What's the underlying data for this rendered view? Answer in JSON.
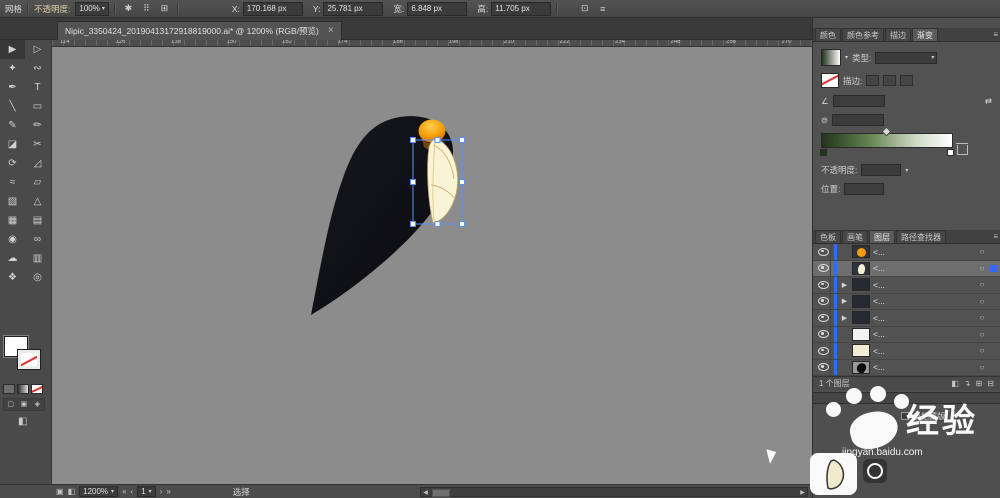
{
  "top_bar": {
    "left_label": "网格",
    "opacity_label": "不透明度:",
    "opacity_value": "100%",
    "dropdown_glyph": "▾",
    "icons": [
      {
        "name": "style-icon",
        "glyph": "✱",
        "slot": "pre"
      },
      {
        "name": "reference-point-icon",
        "glyph": "⠿",
        "slot": "pre"
      },
      {
        "name": "align-icon",
        "glyph": "⊞",
        "slot": "pre"
      },
      {
        "name": "transform-icon",
        "glyph": "⊡",
        "slot": "post"
      },
      {
        "name": "control-menu-icon",
        "glyph": "≡",
        "slot": "post"
      }
    ],
    "fields": [
      {
        "label": "X:",
        "value": "170.168 px"
      },
      {
        "label": "Y:",
        "value": "25.781 px"
      },
      {
        "label": "宽:",
        "value": "6.848 px"
      },
      {
        "label": "高:",
        "value": "11.705 px"
      }
    ]
  },
  "doc_tab": {
    "title": "Nipic_3350424_20190413172918819000.ai* @ 1200% (RGB/预览)",
    "close_glyph": "×"
  },
  "ruler": {
    "start": 114,
    "step": 12,
    "count": 14
  },
  "toolbar": {
    "tools": [
      {
        "name": "selection-tool",
        "glyph": "▶"
      },
      {
        "name": "direct-selection-tool",
        "glyph": "▷"
      },
      {
        "name": "magic-wand-tool",
        "glyph": "✦"
      },
      {
        "name": "lasso-tool",
        "glyph": "∾"
      },
      {
        "name": "pen-tool",
        "glyph": "✒"
      },
      {
        "name": "type-tool",
        "glyph": "T"
      },
      {
        "name": "line-segment-tool",
        "glyph": "╲"
      },
      {
        "name": "rectangle-tool",
        "glyph": "▭"
      },
      {
        "name": "paintbrush-tool",
        "glyph": "✎"
      },
      {
        "name": "pencil-tool",
        "glyph": "✏"
      },
      {
        "name": "eraser-tool",
        "glyph": "◪"
      },
      {
        "name": "scissors-tool",
        "glyph": "✂"
      },
      {
        "name": "rotate-tool",
        "glyph": "⟳"
      },
      {
        "name": "scale-tool",
        "glyph": "◿"
      },
      {
        "name": "width-tool",
        "glyph": "≈"
      },
      {
        "name": "free-transform-tool",
        "glyph": "▱"
      },
      {
        "name": "shape-builder-tool",
        "glyph": "▧"
      },
      {
        "name": "perspective-grid-tool",
        "glyph": "△"
      },
      {
        "name": "mesh-tool",
        "glyph": "▦"
      },
      {
        "name": "gradient-tool",
        "glyph": "▤"
      },
      {
        "name": "eyedropper-tool",
        "glyph": "◉"
      },
      {
        "name": "blend-tool",
        "glyph": "∞"
      },
      {
        "name": "symbol-sprayer-tool",
        "glyph": "☁"
      },
      {
        "name": "column-graph-tool",
        "glyph": "▥"
      },
      {
        "name": "hand-tool",
        "glyph": "❖"
      },
      {
        "name": "zoom-tool",
        "glyph": "◎"
      }
    ],
    "draw_modes": [
      {
        "name": "draw-normal-icon",
        "glyph": "▢"
      },
      {
        "name": "draw-behind-icon",
        "glyph": "▣"
      },
      {
        "name": "draw-inside-icon",
        "glyph": "◈"
      }
    ],
    "screen_mode": {
      "glyph": "◧"
    }
  },
  "artwork": {
    "body_color": "#0a0a10",
    "head_color": "#f59d08",
    "belly_color": "#faf4d6",
    "outline_color": "#bba968",
    "selection_color": "#5b8ef7"
  },
  "right_panels": {
    "panel_menu_glyph": "≡",
    "tab_group1": [
      {
        "id": "color",
        "label": "颜色",
        "active": false
      },
      {
        "id": "color-guide",
        "label": "颜色参考",
        "active": false
      },
      {
        "id": "stroke",
        "label": "描边",
        "active": false
      },
      {
        "id": "gradient",
        "label": "渐变",
        "active": true
      }
    ],
    "gradient": {
      "type_label": "类型:",
      "stroke_label": "描边:",
      "angle_glyph": "∠",
      "aspect_glyph": "⊜",
      "reverse_glyph": "⇄",
      "opacity_label": "不透明度:",
      "position_label": "位置:",
      "from": "#22351d",
      "to": "#ffffff"
    },
    "tab_group2": [
      {
        "id": "swatches",
        "label": "色板",
        "active": false
      },
      {
        "id": "brushes",
        "label": "画笔",
        "active": false
      },
      {
        "id": "layers",
        "label": "图层",
        "active": true
      },
      {
        "id": "pathfinder",
        "label": "路径查找器",
        "active": false
      }
    ],
    "layers": {
      "expand_glyph": "▶",
      "target_glyph": "○",
      "rows": [
        {
          "label": "<...",
          "thumb": "head",
          "expand": false,
          "selected": false
        },
        {
          "label": "<...",
          "thumb": "belly",
          "expand": false,
          "selected": true
        },
        {
          "label": "<...",
          "thumb": "dark",
          "expand": true,
          "selected": false
        },
        {
          "label": "<...",
          "thumb": "dark",
          "expand": true,
          "selected": false
        },
        {
          "label": "<...",
          "thumb": "dark",
          "expand": true,
          "selected": false
        },
        {
          "label": "<...",
          "thumb": "white",
          "expand": false,
          "selected": false
        },
        {
          "label": "<...",
          "thumb": "pale",
          "expand": false,
          "selected": false
        },
        {
          "label": "<...",
          "thumb": "bird",
          "expand": false,
          "selected": false
        }
      ],
      "footer_count": "1 个图层",
      "footer_icons": [
        {
          "name": "make-clipping-mask-icon",
          "glyph": "◧"
        },
        {
          "name": "create-sublayer-icon",
          "glyph": "↴"
        },
        {
          "name": "new-layer-icon",
          "glyph": "⊞"
        },
        {
          "name": "delete-layer-icon",
          "glyph": "⊟"
        }
      ]
    },
    "transparency": {
      "invert_mask_label": "反相蒙版"
    }
  },
  "status_bar": {
    "icons": [
      {
        "name": "arrange-documents-icon",
        "glyph": "▣"
      },
      {
        "name": "document-setup-icon",
        "glyph": "◧"
      }
    ],
    "zoom_value": "1200%",
    "dropdown_glyph": "▾",
    "nav": {
      "first": "«",
      "prev": "‹",
      "next": "›",
      "last": "»"
    },
    "artboard_value": "1",
    "status_text": "选择",
    "scroll_left_glyph": "◀",
    "scroll_right_glyph": "▶"
  },
  "watermark": {
    "brand": "经验",
    "site": "jingyan.baidu.com"
  }
}
